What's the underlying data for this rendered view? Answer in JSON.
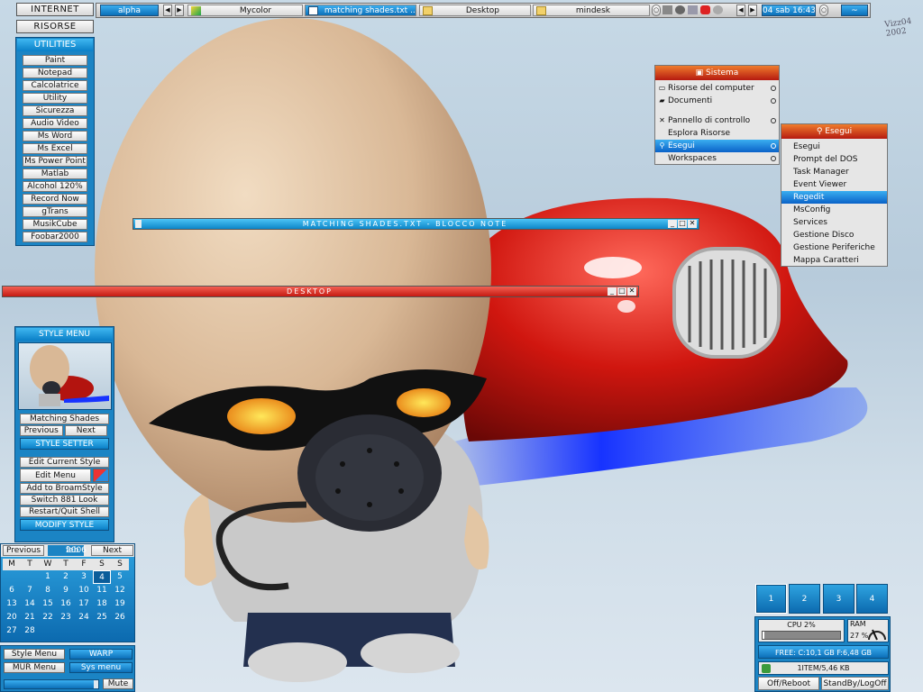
{
  "desktop": {
    "signature": "Vizz04 2002"
  },
  "left_nav": {
    "internet": "INTERNET",
    "risorse": "RISORSE"
  },
  "utilities": {
    "title": "UTILITIES",
    "items": [
      "Paint",
      "Notepad",
      "Calcolatrice",
      "Utility",
      "Sicurezza",
      "Audio Video",
      "Ms Word",
      "Ms Excel",
      "Ms Power Point",
      "Matlab",
      "Alcohol 120%",
      "Record Now",
      "gTrans",
      "MusikCube",
      "Foobar2000"
    ]
  },
  "taskbar": {
    "workspace": "alpha",
    "tasks": [
      "Mycolor",
      "matching shades.txt ...",
      "Desktop",
      "mindesk"
    ],
    "active_task_index": 1,
    "clock": "04 sab 16:43"
  },
  "windows": {
    "notepad_title": "MATCHING SHADES.TXT - BLOCCO NOTE",
    "desktop_title": "DESKTOP"
  },
  "sistema_menu": {
    "title": "Sistema",
    "items": [
      {
        "label": "Risorse del computer",
        "icon": "computer-icon",
        "submenu": true
      },
      {
        "label": "Documenti",
        "icon": "folder-icon",
        "submenu": true
      },
      {
        "label": "",
        "icon": "",
        "submenu": false
      },
      {
        "label": "Pannello di controllo",
        "icon": "tools-icon",
        "submenu": true
      },
      {
        "label": "Esplora Risorse",
        "icon": "",
        "submenu": false
      },
      {
        "label": "Esegui",
        "icon": "run-icon",
        "submenu": true,
        "selected": true
      },
      {
        "label": "Workspaces",
        "icon": "",
        "submenu": true
      }
    ]
  },
  "esegui_menu": {
    "title": "Esegui",
    "items": [
      "Esegui",
      "Prompt del DOS",
      "Task Manager",
      "Event Viewer",
      "Regedit",
      "MsConfig",
      "Services",
      "Gestione Disco",
      "Gestione Periferiche",
      "Mappa Caratteri"
    ],
    "selected_index": 4
  },
  "style_menu": {
    "title": "STYLE MENU",
    "style_name": "Matching Shades",
    "previous": "Previous",
    "next": "Next",
    "style_setter": "STYLE SETTER",
    "actions": [
      "Edit Current Style",
      "Edit Menu",
      "Add to BroamStyle",
      "Switch 881 Look",
      "Restart/Quit Shell"
    ],
    "modify": "MODIFY STYLE"
  },
  "calendar": {
    "previous": "Previous",
    "month": "feb",
    "year": "2006",
    "next": "Next",
    "day_headers": [
      "M",
      "T",
      "W",
      "T",
      "F",
      "S",
      "S"
    ],
    "days": [
      "",
      "",
      "1",
      "2",
      "3",
      "4",
      "5",
      "6",
      "7",
      "8",
      "9",
      "10",
      "11",
      "12",
      "13",
      "14",
      "15",
      "16",
      "17",
      "18",
      "19",
      "20",
      "21",
      "22",
      "23",
      "24",
      "25",
      "26",
      "27",
      "28",
      "",
      "",
      "",
      "",
      ""
    ],
    "today": "4"
  },
  "bottom_left": {
    "style_menu": "Style Menu",
    "warp": "WARP",
    "mur_menu": "MUR Menu",
    "sys_menu": "Sys menu",
    "mute": "Mute",
    "volume_level": 0.95
  },
  "bottom_right": {
    "workspaces": [
      "1",
      "2",
      "3",
      "4"
    ],
    "current_workspace": "1",
    "cpu": "CPU 2%",
    "ram": "RAM",
    "ram_value": "27 %",
    "free": "FREE: C:10,1 GB F:6,48 GB",
    "bin": "1ITEM/5,46 KB",
    "off_reboot": "Off/Reboot",
    "standby": "StandBy/LogOff"
  },
  "colors": {
    "accent_blue": "#1b84c4",
    "menu_title_red": "#c42315",
    "selected_blue": "#0a62c8"
  }
}
